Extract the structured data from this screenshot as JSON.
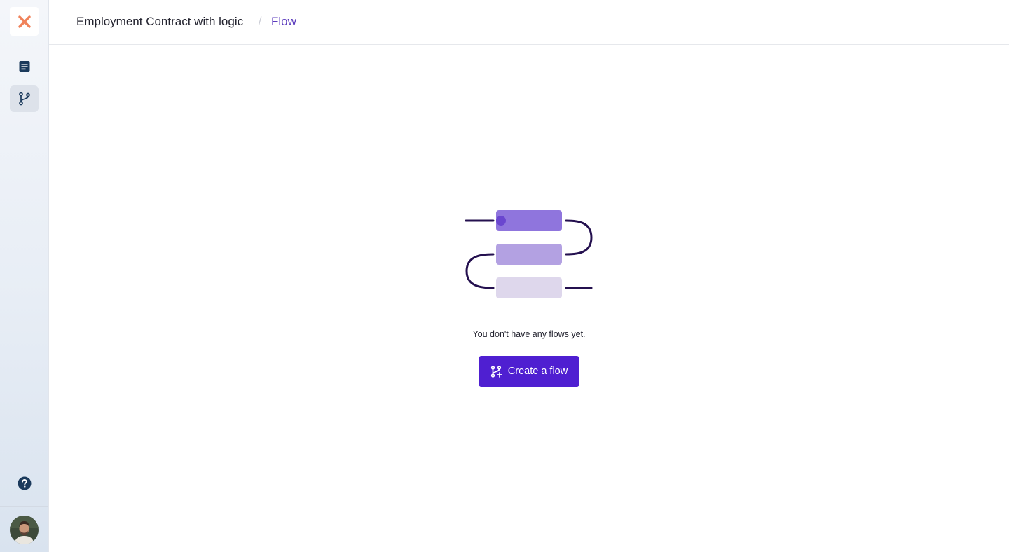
{
  "sidebar": {
    "logo_icon": "x-logo-icon",
    "items": [
      {
        "name": "document",
        "icon": "document-icon",
        "active": false
      },
      {
        "name": "flow",
        "icon": "branch-icon",
        "active": true
      }
    ],
    "help_icon": "question-circle-icon",
    "avatar_icon": "user-avatar"
  },
  "breadcrumb": {
    "document_title": "Employment Contract with logic",
    "separator": "/",
    "current": "Flow"
  },
  "empty_state": {
    "message": "You don't have any flows yet.",
    "button_label": "Create a flow",
    "button_icon": "branch-plus-icon"
  },
  "colors": {
    "accent": "#4f1fd1",
    "breadcrumb_active": "#5b3bbd",
    "logo": "#f0825a",
    "sidebar_icon": "#1b3a5c"
  }
}
